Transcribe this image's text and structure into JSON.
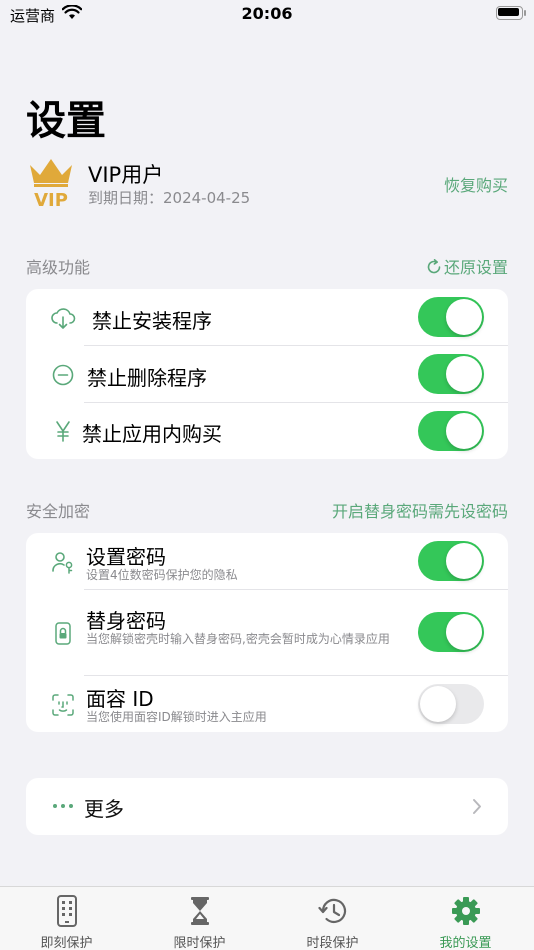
{
  "status_bar": {
    "carrier": "运营商",
    "time": "20:06"
  },
  "page": {
    "title": "设置"
  },
  "vip": {
    "name": "VIP用户",
    "expiry": "到期日期：2024-04-25",
    "restore_label": "恢复购买",
    "badge_text": "VIP"
  },
  "advanced": {
    "header": "高级功能",
    "action_label": "还原设置",
    "items": [
      {
        "label": "禁止安装程序",
        "icon": "cloud-download-icon",
        "enabled": true
      },
      {
        "label": "禁止删除程序",
        "icon": "minus-circle-icon",
        "enabled": true
      },
      {
        "label": "禁止应用内购买",
        "icon": "yen-icon",
        "enabled": true
      }
    ]
  },
  "security": {
    "header": "安全加密",
    "action_label": "开启替身密码需先设密码",
    "items": [
      {
        "label": "设置密码",
        "sub": "设置4位数密码保护您的隐私",
        "icon": "user-key-icon",
        "enabled": true
      },
      {
        "label": "替身密码",
        "sub": "当您解锁密壳时输入替身密码,密壳会暂时成为心情录应用",
        "icon": "lock-icon",
        "enabled": true
      },
      {
        "label": "面容 ID",
        "sub": "当您使用面容ID解锁时进入主应用",
        "icon": "face-id-icon",
        "enabled": false
      }
    ]
  },
  "more": {
    "label": "更多",
    "icon": "ellipsis-icon"
  },
  "tabbar": {
    "tabs": [
      {
        "label": "即刻保护",
        "icon": "phone-icon",
        "active": false
      },
      {
        "label": "限时保护",
        "icon": "hourglass-icon",
        "active": false
      },
      {
        "label": "时段保护",
        "icon": "clock-history-icon",
        "active": false
      },
      {
        "label": "我的设置",
        "icon": "gear-icon",
        "active": true
      }
    ]
  },
  "colors": {
    "accent_green": "#5aa87a",
    "toggle_on": "#34c759",
    "active_tab": "#3a9a55",
    "vip_gold": "#e0a93a"
  }
}
